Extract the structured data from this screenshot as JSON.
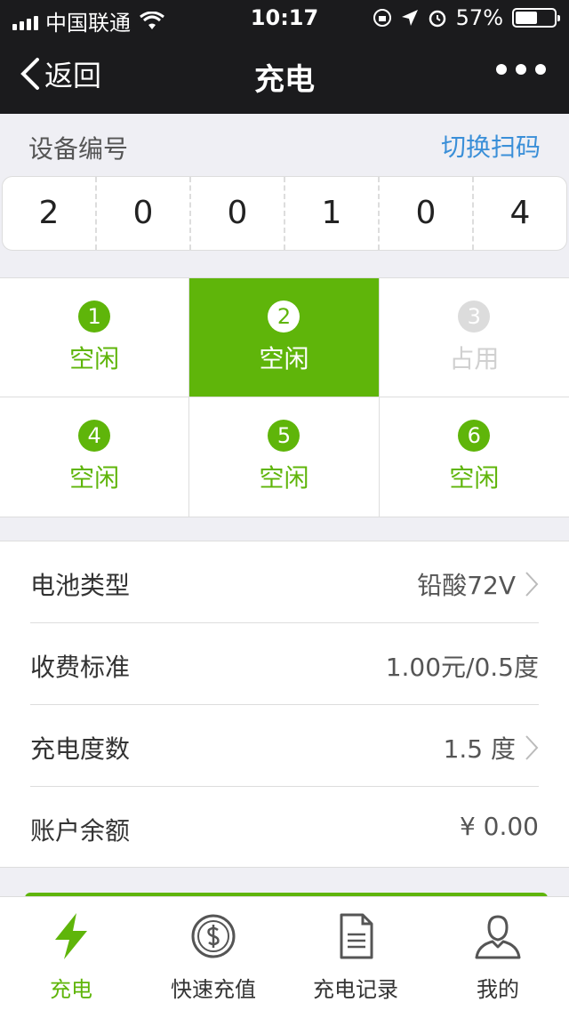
{
  "status_bar": {
    "carrier": "中国联通",
    "time": "10:17",
    "battery_text": "57%",
    "battery_level": 0.57
  },
  "nav": {
    "back_label": "返回",
    "title": "充电"
  },
  "device": {
    "label": "设备编号",
    "switch_label": "切换扫码",
    "digits": [
      "2",
      "0",
      "0",
      "1",
      "0",
      "4"
    ]
  },
  "ports": [
    {
      "num": "1",
      "status": "空闲",
      "state": "free"
    },
    {
      "num": "2",
      "status": "空闲",
      "state": "selected"
    },
    {
      "num": "3",
      "status": "占用",
      "state": "busy"
    },
    {
      "num": "4",
      "status": "空闲",
      "state": "free"
    },
    {
      "num": "5",
      "status": "空闲",
      "state": "free"
    },
    {
      "num": "6",
      "status": "空闲",
      "state": "free"
    }
  ],
  "info": [
    {
      "key": "电池类型",
      "value": "铅酸72V",
      "arrow": true
    },
    {
      "key": "收费标准",
      "value": "1.00元/0.5度",
      "arrow": false
    },
    {
      "key": "充电度数",
      "value": "1.5 度",
      "arrow": true
    },
    {
      "key": "账户余额",
      "value": "¥ 0.00",
      "arrow": false
    }
  ],
  "tabs": [
    {
      "label": "充电",
      "icon": "lightning-icon",
      "active": true
    },
    {
      "label": "快速充值",
      "icon": "dollar-coin-icon",
      "active": false
    },
    {
      "label": "充电记录",
      "icon": "document-icon",
      "active": false
    },
    {
      "label": "我的",
      "icon": "user-icon",
      "active": false
    }
  ],
  "colors": {
    "accent": "#5fb50a",
    "link": "#3a8fd8",
    "nav_bg": "#1b1b1d",
    "busy": "#d0d0d0"
  }
}
